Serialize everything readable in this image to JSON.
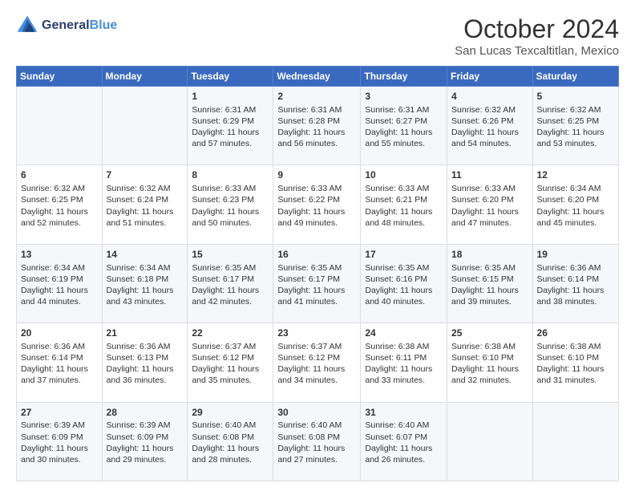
{
  "header": {
    "logo_line1": "General",
    "logo_line2": "Blue",
    "main_title": "October 2024",
    "subtitle": "San Lucas Texcaltitlan, Mexico"
  },
  "days_of_week": [
    "Sunday",
    "Monday",
    "Tuesday",
    "Wednesday",
    "Thursday",
    "Friday",
    "Saturday"
  ],
  "weeks": [
    [
      {
        "day": "",
        "info": ""
      },
      {
        "day": "",
        "info": ""
      },
      {
        "day": "1",
        "info": "Sunrise: 6:31 AM\nSunset: 6:29 PM\nDaylight: 11 hours and 57 minutes."
      },
      {
        "day": "2",
        "info": "Sunrise: 6:31 AM\nSunset: 6:28 PM\nDaylight: 11 hours and 56 minutes."
      },
      {
        "day": "3",
        "info": "Sunrise: 6:31 AM\nSunset: 6:27 PM\nDaylight: 11 hours and 55 minutes."
      },
      {
        "day": "4",
        "info": "Sunrise: 6:32 AM\nSunset: 6:26 PM\nDaylight: 11 hours and 54 minutes."
      },
      {
        "day": "5",
        "info": "Sunrise: 6:32 AM\nSunset: 6:25 PM\nDaylight: 11 hours and 53 minutes."
      }
    ],
    [
      {
        "day": "6",
        "info": "Sunrise: 6:32 AM\nSunset: 6:25 PM\nDaylight: 11 hours and 52 minutes."
      },
      {
        "day": "7",
        "info": "Sunrise: 6:32 AM\nSunset: 6:24 PM\nDaylight: 11 hours and 51 minutes."
      },
      {
        "day": "8",
        "info": "Sunrise: 6:33 AM\nSunset: 6:23 PM\nDaylight: 11 hours and 50 minutes."
      },
      {
        "day": "9",
        "info": "Sunrise: 6:33 AM\nSunset: 6:22 PM\nDaylight: 11 hours and 49 minutes."
      },
      {
        "day": "10",
        "info": "Sunrise: 6:33 AM\nSunset: 6:21 PM\nDaylight: 11 hours and 48 minutes."
      },
      {
        "day": "11",
        "info": "Sunrise: 6:33 AM\nSunset: 6:20 PM\nDaylight: 11 hours and 47 minutes."
      },
      {
        "day": "12",
        "info": "Sunrise: 6:34 AM\nSunset: 6:20 PM\nDaylight: 11 hours and 45 minutes."
      }
    ],
    [
      {
        "day": "13",
        "info": "Sunrise: 6:34 AM\nSunset: 6:19 PM\nDaylight: 11 hours and 44 minutes."
      },
      {
        "day": "14",
        "info": "Sunrise: 6:34 AM\nSunset: 6:18 PM\nDaylight: 11 hours and 43 minutes."
      },
      {
        "day": "15",
        "info": "Sunrise: 6:35 AM\nSunset: 6:17 PM\nDaylight: 11 hours and 42 minutes."
      },
      {
        "day": "16",
        "info": "Sunrise: 6:35 AM\nSunset: 6:17 PM\nDaylight: 11 hours and 41 minutes."
      },
      {
        "day": "17",
        "info": "Sunrise: 6:35 AM\nSunset: 6:16 PM\nDaylight: 11 hours and 40 minutes."
      },
      {
        "day": "18",
        "info": "Sunrise: 6:35 AM\nSunset: 6:15 PM\nDaylight: 11 hours and 39 minutes."
      },
      {
        "day": "19",
        "info": "Sunrise: 6:36 AM\nSunset: 6:14 PM\nDaylight: 11 hours and 38 minutes."
      }
    ],
    [
      {
        "day": "20",
        "info": "Sunrise: 6:36 AM\nSunset: 6:14 PM\nDaylight: 11 hours and 37 minutes."
      },
      {
        "day": "21",
        "info": "Sunrise: 6:36 AM\nSunset: 6:13 PM\nDaylight: 11 hours and 36 minutes."
      },
      {
        "day": "22",
        "info": "Sunrise: 6:37 AM\nSunset: 6:12 PM\nDaylight: 11 hours and 35 minutes."
      },
      {
        "day": "23",
        "info": "Sunrise: 6:37 AM\nSunset: 6:12 PM\nDaylight: 11 hours and 34 minutes."
      },
      {
        "day": "24",
        "info": "Sunrise: 6:38 AM\nSunset: 6:11 PM\nDaylight: 11 hours and 33 minutes."
      },
      {
        "day": "25",
        "info": "Sunrise: 6:38 AM\nSunset: 6:10 PM\nDaylight: 11 hours and 32 minutes."
      },
      {
        "day": "26",
        "info": "Sunrise: 6:38 AM\nSunset: 6:10 PM\nDaylight: 11 hours and 31 minutes."
      }
    ],
    [
      {
        "day": "27",
        "info": "Sunrise: 6:39 AM\nSunset: 6:09 PM\nDaylight: 11 hours and 30 minutes."
      },
      {
        "day": "28",
        "info": "Sunrise: 6:39 AM\nSunset: 6:09 PM\nDaylight: 11 hours and 29 minutes."
      },
      {
        "day": "29",
        "info": "Sunrise: 6:40 AM\nSunset: 6:08 PM\nDaylight: 11 hours and 28 minutes."
      },
      {
        "day": "30",
        "info": "Sunrise: 6:40 AM\nSunset: 6:08 PM\nDaylight: 11 hours and 27 minutes."
      },
      {
        "day": "31",
        "info": "Sunrise: 6:40 AM\nSunset: 6:07 PM\nDaylight: 11 hours and 26 minutes."
      },
      {
        "day": "",
        "info": ""
      },
      {
        "day": "",
        "info": ""
      }
    ]
  ]
}
